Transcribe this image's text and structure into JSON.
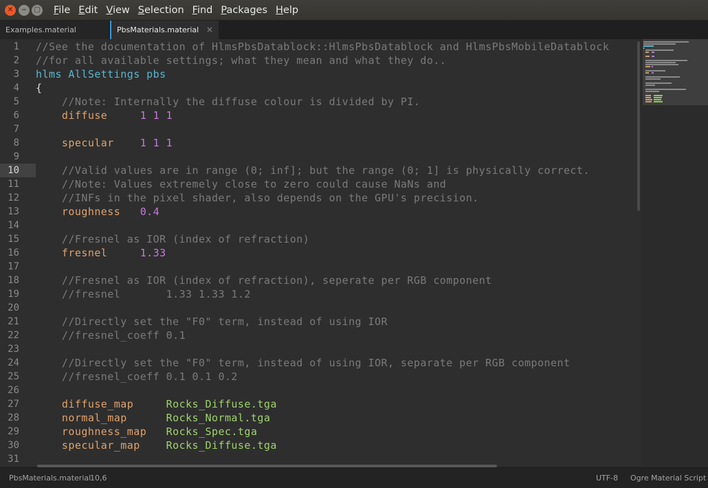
{
  "window": {
    "close_glyph": "✕",
    "min_glyph": "−",
    "max_glyph": "□"
  },
  "menu": [
    {
      "accel": "F",
      "rest": "ile"
    },
    {
      "accel": "E",
      "rest": "dit"
    },
    {
      "accel": "V",
      "rest": "iew"
    },
    {
      "accel": "S",
      "rest": "election"
    },
    {
      "accel": "F",
      "rest": "ind"
    },
    {
      "accel": "P",
      "rest": "ackages"
    },
    {
      "accel": "H",
      "rest": "elp"
    }
  ],
  "tabs": [
    {
      "label": "Examples.material",
      "active": false
    },
    {
      "label": "PbsMaterials.material",
      "active": true,
      "close_glyph": "×"
    }
  ],
  "editor": {
    "current_line": 10,
    "lines": [
      [
        [
          "comment",
          "//See the documentation of HlmsPbsDatablock::HlmsPbsDatablock and HlmsPbsMobileDatablock"
        ]
      ],
      [
        [
          "comment",
          "//for all available settings; what they mean and what they do.."
        ]
      ],
      [
        [
          "block",
          "hlms AllSettings pbs"
        ]
      ],
      [
        [
          "plain",
          "{"
        ]
      ],
      [
        [
          "comment",
          "    //Note: Internally the diffuse colour is divided by PI."
        ]
      ],
      [
        [
          "keyword",
          "    diffuse     "
        ],
        [
          "number",
          "1 1 1"
        ]
      ],
      [],
      [
        [
          "keyword",
          "    specular    "
        ],
        [
          "number",
          "1 1 1"
        ]
      ],
      [],
      [
        [
          "comment",
          "    //Valid values are in range (0; inf]; but the range (0; 1] is physically correct."
        ]
      ],
      [
        [
          "comment",
          "    //Note: Values extremely close to zero could cause NaNs and"
        ]
      ],
      [
        [
          "comment",
          "    //INFs in the pixel shader, also depends on the GPU's precision."
        ]
      ],
      [
        [
          "keyword",
          "    roughness   "
        ],
        [
          "number",
          "0.4"
        ]
      ],
      [],
      [
        [
          "comment",
          "    //Fresnel as IOR (index of refraction)"
        ]
      ],
      [
        [
          "keyword",
          "    fresnel     "
        ],
        [
          "number",
          "1.33"
        ]
      ],
      [],
      [
        [
          "comment",
          "    //Fresnel as IOR (index of refraction), seperate per RGB component"
        ]
      ],
      [
        [
          "comment",
          "    //fresnel       1.33 1.33 1.2"
        ]
      ],
      [],
      [
        [
          "comment",
          "    //Directly set the \"F0\" term, instead of using IOR"
        ]
      ],
      [
        [
          "comment",
          "    //fresnel_coeff 0.1"
        ]
      ],
      [],
      [
        [
          "comment",
          "    //Directly set the \"F0\" term, instead of using IOR, separate per RGB component"
        ]
      ],
      [
        [
          "comment",
          "    //fresnel_coeff 0.1 0.1 0.2"
        ]
      ],
      [],
      [
        [
          "keyword",
          "    diffuse_map     "
        ],
        [
          "string",
          "Rocks_Diffuse.tga"
        ]
      ],
      [
        [
          "keyword",
          "    normal_map      "
        ],
        [
          "string",
          "Rocks_Normal.tga"
        ]
      ],
      [
        [
          "keyword",
          "    roughness_map   "
        ],
        [
          "string",
          "Rocks_Spec.tga"
        ]
      ],
      [
        [
          "keyword",
          "    specular_map    "
        ],
        [
          "string",
          "Rocks_Diffuse.tga"
        ]
      ],
      []
    ]
  },
  "status": {
    "file": "PbsMaterials.material",
    "position": "10,6",
    "encoding": "UTF-8",
    "syntax": "Ogre Material Script"
  }
}
